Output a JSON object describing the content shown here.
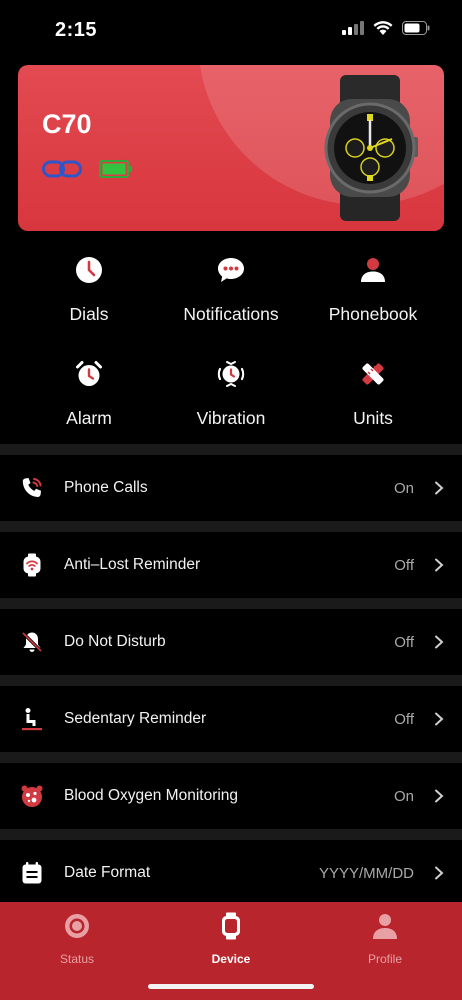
{
  "status_bar": {
    "time": "2:15",
    "icons": [
      "signal-icon",
      "wifi-icon",
      "battery-icon"
    ]
  },
  "device": {
    "name": "C70",
    "card_color": "#d8363e",
    "connection_icon": "link-icon",
    "connection_color": "#2d56c8",
    "battery_icon": "battery-full-icon",
    "battery_color": "#33c43f"
  },
  "quick_actions": [
    {
      "label": "Dials",
      "icon": "clock-icon"
    },
    {
      "label": "Notifications",
      "icon": "chat-bubble-icon"
    },
    {
      "label": "Phonebook",
      "icon": "person-icon"
    },
    {
      "label": "Alarm",
      "icon": "alarm-clock-icon"
    },
    {
      "label": "Vibration",
      "icon": "vibration-icon"
    },
    {
      "label": "Units",
      "icon": "ruler-icon"
    }
  ],
  "settings": [
    {
      "label": "Phone Calls",
      "value": "On",
      "icon": "phone-icon"
    },
    {
      "label": "Anti–Lost Reminder",
      "value": "Off",
      "icon": "wifi-watch-icon"
    },
    {
      "label": "Do Not Disturb",
      "value": "Off",
      "icon": "bell-off-icon"
    },
    {
      "label": "Sedentary Reminder",
      "value": "Off",
      "icon": "sitting-person-icon"
    },
    {
      "label": "Blood Oxygen Monitoring",
      "value": "On",
      "icon": "blood-oxygen-icon"
    },
    {
      "label": "Date Format",
      "value": "YYYY/MM/DD",
      "icon": "calendar-icon"
    }
  ],
  "tabs": [
    {
      "label": "Status",
      "icon": "status-ring-icon",
      "active": false
    },
    {
      "label": "Device",
      "icon": "watch-icon",
      "active": true
    },
    {
      "label": "Profile",
      "icon": "profile-icon",
      "active": false
    }
  ],
  "colors": {
    "accent": "#c8282f",
    "tab_bar": "#b8252d",
    "icon_red": "#d23a42",
    "background": "#000000",
    "separator": "#1a1a1a"
  }
}
